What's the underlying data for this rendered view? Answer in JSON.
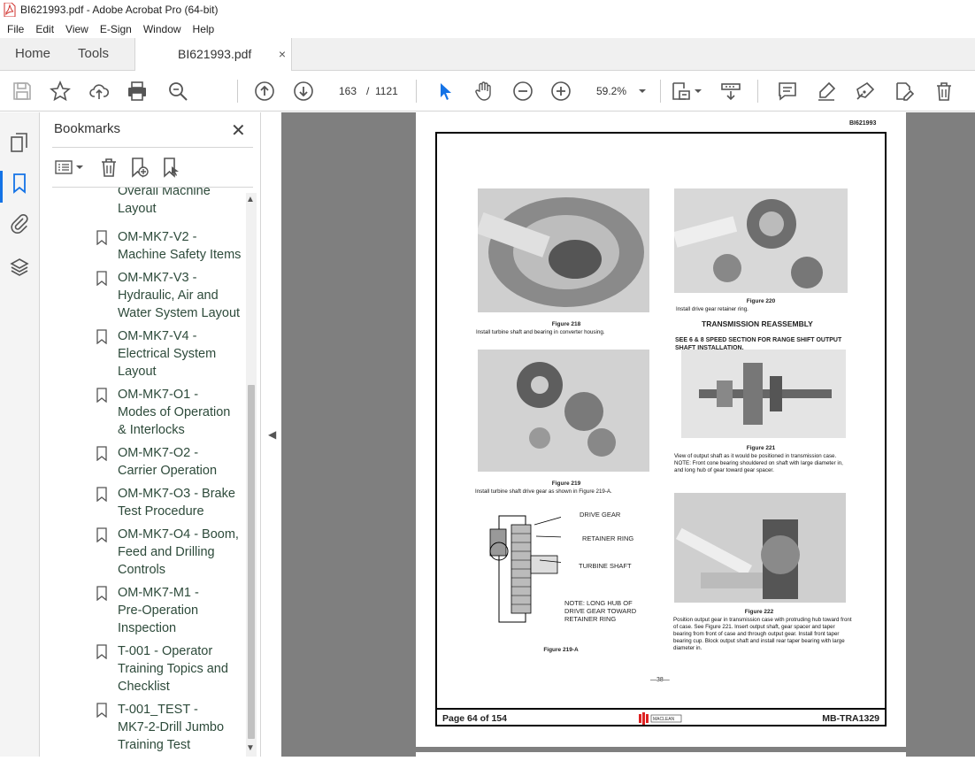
{
  "window": {
    "title": "BI621993.pdf - Adobe Acrobat Pro (64-bit)"
  },
  "menu": [
    "File",
    "Edit",
    "View",
    "E-Sign",
    "Window",
    "Help"
  ],
  "tabs": {
    "home": "Home",
    "tools": "Tools",
    "document": "BI621993.pdf",
    "close": "×"
  },
  "toolbar": {
    "current_page": "163",
    "page_separator": "/",
    "total_pages": "1121",
    "zoom": "59.2%"
  },
  "bookmarks": {
    "title": "Bookmarks",
    "items": [
      {
        "label": "Overall Machine Layout",
        "lines": [
          "Overall Machine",
          "Layout"
        ]
      },
      {
        "label": "OM-MK7-V2 - Machine Safety Items",
        "lines": [
          "OM-MK7-V2 -",
          "Machine Safety Items"
        ]
      },
      {
        "label": "OM-MK7-V3 - Hydraulic, Air and Water System Layout",
        "lines": [
          "OM-MK7-V3 -",
          "Hydraulic, Air and",
          "Water System Layout"
        ]
      },
      {
        "label": "OM-MK7-V4 - Electrical System Layout",
        "lines": [
          "OM-MK7-V4 -",
          "Electrical System",
          "Layout"
        ]
      },
      {
        "label": "OM-MK7-O1 - Modes of Operation & Interlocks",
        "lines": [
          "OM-MK7-O1 -",
          "Modes of Operation",
          "& Interlocks"
        ]
      },
      {
        "label": "OM-MK7-O2 - Carrier Operation",
        "lines": [
          "OM-MK7-O2 -",
          "Carrier Operation"
        ]
      },
      {
        "label": "OM-MK7-O3 - Brake Test Procedure",
        "lines": [
          "OM-MK7-O3 - Brake",
          "Test Procedure"
        ]
      },
      {
        "label": "OM-MK7-O4 - Boom, Feed and Drilling Controls",
        "lines": [
          "OM-MK7-O4 - Boom,",
          "Feed and Drilling",
          "Controls"
        ]
      },
      {
        "label": "OM-MK7-M1 - Pre-Operation Inspection",
        "lines": [
          "OM-MK7-M1 -",
          "Pre-Operation",
          "Inspection"
        ]
      },
      {
        "label": "T-001 - Operator Training Topics and Checklist",
        "lines": [
          "T-001 - Operator",
          "Training Topics and",
          "Checklist"
        ]
      },
      {
        "label": "T-001_TEST - MK7-2-Drill Jumbo Training Test",
        "lines": [
          "T-001_TEST -",
          "MK7-2-Drill Jumbo",
          "Training Test"
        ]
      }
    ]
  },
  "document_page": {
    "doc_id": "BI621993",
    "fig218": {
      "title": "Figure 218",
      "caption": "Install turbine shaft and bearing in converter housing."
    },
    "fig220": {
      "title": "Figure 220",
      "caption": "Install drive gear retainer ring."
    },
    "heading": "TRANSMISSION REASSEMBLY",
    "subheading": "SEE 6 & 8 SPEED SECTION FOR RANGE SHIFT OUTPUT SHAFT INSTALLATION.",
    "fig219": {
      "title": "Figure 219",
      "caption": "Install turbine shaft drive gear as shown in Figure 219-A."
    },
    "fig221": {
      "title": "Figure 221",
      "caption": "View of output shaft as it would be positioned in transmission case. NOTE: Front cone bearing shouldered on shaft with large diameter in, and long hub of gear toward gear spacer."
    },
    "fig219a": {
      "title": "Figure 219-A",
      "labels": {
        "drive_gear": "DRIVE GEAR",
        "retainer_ring": "RETAINER RING",
        "turbine_shaft": "TURBINE SHAFT",
        "note": "NOTE: LONG HUB OF DRIVE GEAR TOWARD RETAINER RING"
      }
    },
    "fig222": {
      "title": "Figure 222",
      "caption": "Position output gear in transmission case with protruding hub toward front of case. See Figure 221. Insert output shaft, gear spacer and taper bearing from front of case and through output gear. Install front taper bearing cup. Block output shaft and install rear taper bearing with large diameter in."
    },
    "page_number": "—38—",
    "footer_left": "Page 64 of 154",
    "footer_logo": "MACLEAN CANADA",
    "footer_right": "MB-TRA1329"
  }
}
